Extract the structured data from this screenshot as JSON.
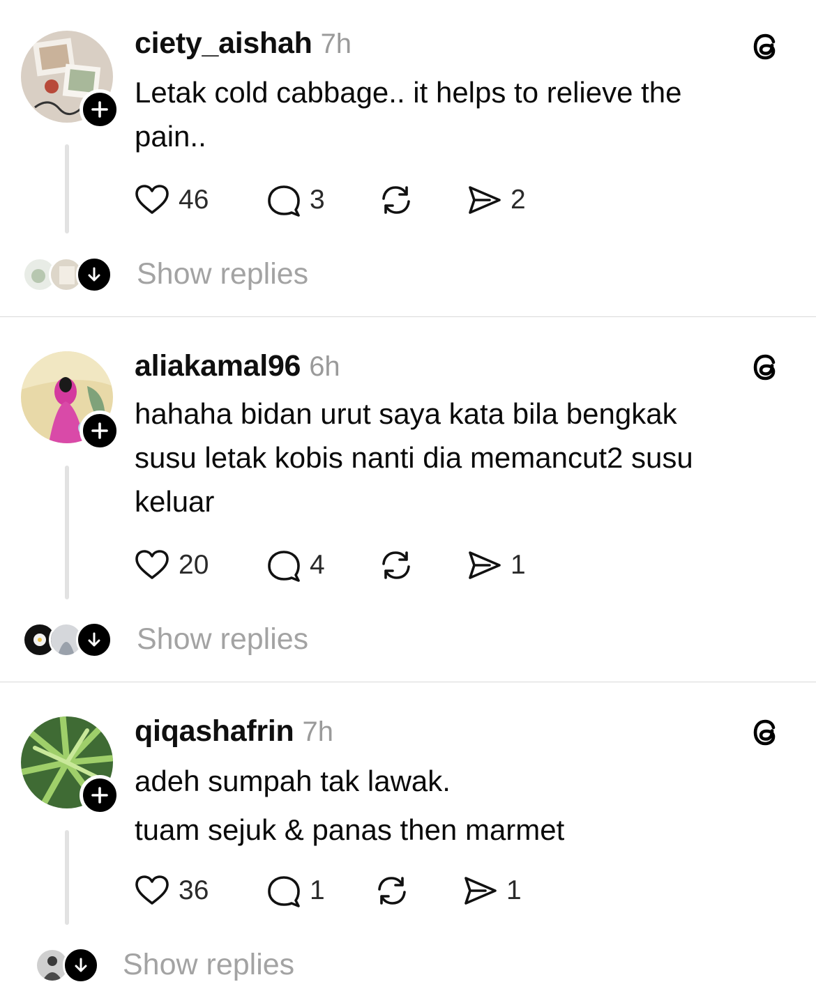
{
  "posts": [
    {
      "username": "ciety_aishah",
      "time": "7h",
      "lines": [
        "Letak cold cabbage.. it helps to relieve the",
        "pain.."
      ],
      "likes": "46",
      "comments": "3",
      "shares": "2",
      "show_replies": "Show replies"
    },
    {
      "username": "aliakamal96",
      "time": "6h",
      "lines": [
        "hahaha bidan urut saya kata bila bengkak",
        "susu letak kobis nanti dia memancut2 susu",
        "keluar"
      ],
      "likes": "20",
      "comments": "4",
      "shares": "1",
      "show_replies": "Show replies"
    },
    {
      "username": "qiqashafrin",
      "time": "7h",
      "lines": [
        "adeh sumpah tak lawak.",
        "tuam sejuk & panas then marmet"
      ],
      "likes": "36",
      "comments": "1",
      "shares": "1",
      "show_replies": "Show replies"
    }
  ],
  "icons": {
    "like": "heart-icon",
    "comment": "comment-bubble-icon",
    "repost": "repost-icon",
    "share": "send-icon",
    "app": "threads-logo-icon",
    "follow": "plus-icon",
    "expand": "arrow-down-icon"
  }
}
